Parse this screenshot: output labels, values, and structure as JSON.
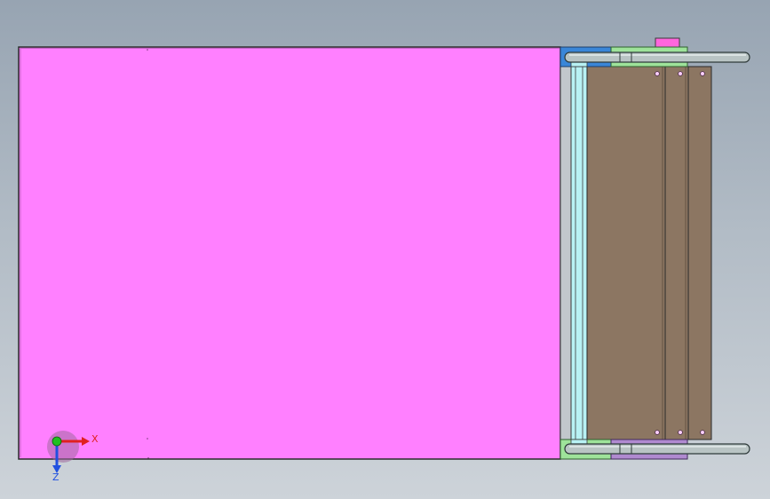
{
  "viewport": {
    "name": "cad-3d-viewport",
    "background": [
      "#97a4b2",
      "#cdd3d9"
    ]
  },
  "model": {
    "panel_color": "#ff80ff",
    "outline_color": "#2a2a2a",
    "frame_color": "#c2c7cc",
    "rail_color": "#b8f2f4",
    "plate_color": "#8c7662",
    "bolt_color": "#ffd0ff",
    "handle_color": "#b9c4c4",
    "bracket_blue": "#3a86d8",
    "bracket_green": "#9ee39a",
    "bracket_violet": "#b08ad0",
    "tab_color": "#ff66dd"
  },
  "triad": {
    "x_label": "X",
    "z_label": "Z",
    "x_color": "#e02020",
    "y_color": "#20c020",
    "z_color": "#2050e0"
  }
}
